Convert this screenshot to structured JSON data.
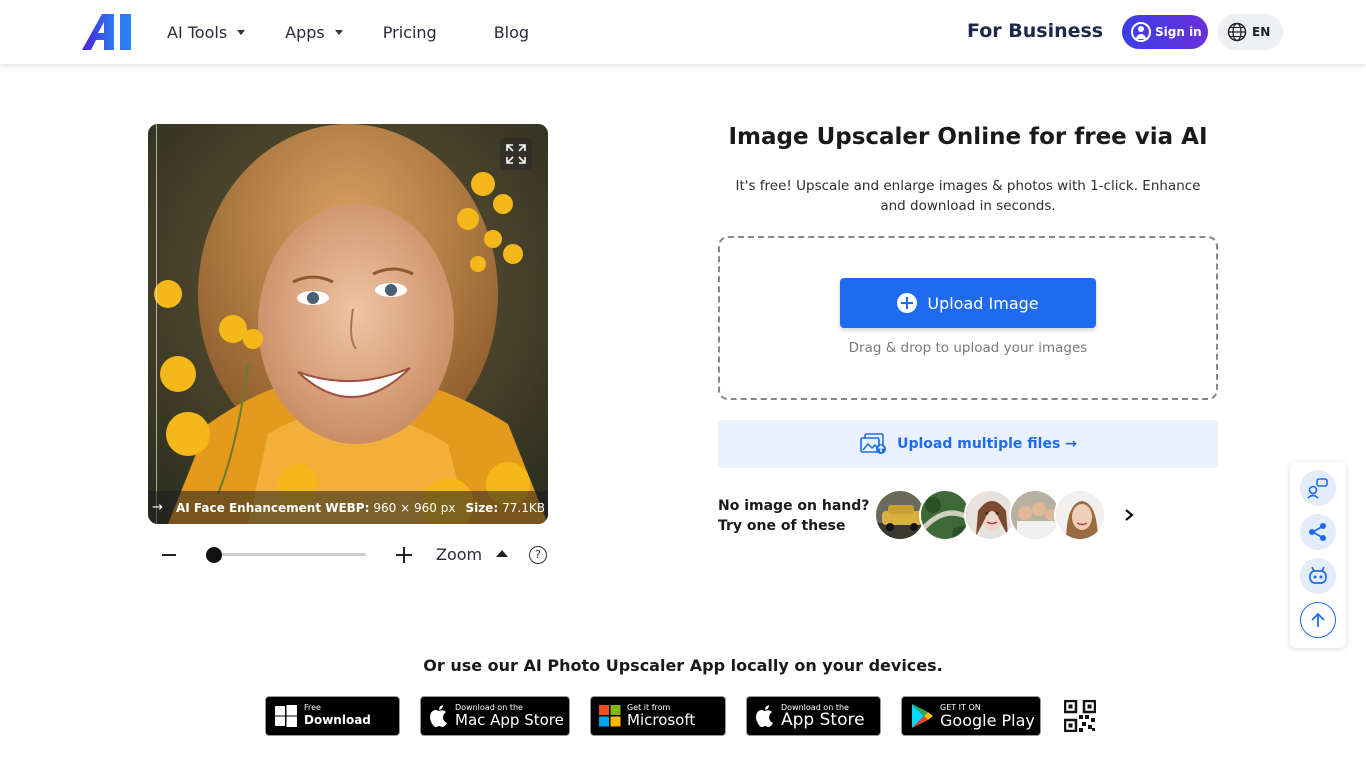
{
  "header": {
    "logo_text": "AI",
    "nav": [
      {
        "label": "AI Tools",
        "dropdown": true
      },
      {
        "label": "Apps",
        "dropdown": true
      },
      {
        "label": "Pricing",
        "dropdown": false
      },
      {
        "label": "Blog",
        "dropdown": false
      }
    ],
    "for_business": "For Business",
    "sign_in": "Sign in",
    "language": "EN"
  },
  "preview": {
    "info_title": "AI Face Enhancement WEBP:",
    "dimensions": "960 × 960 px",
    "size_label": "Size:",
    "size_value": "77.1KB",
    "compare_arrow": "→"
  },
  "zoom": {
    "label": "Zoom",
    "help": "?",
    "level": 0.05
  },
  "main": {
    "title": "Image Upscaler Online for free via AI",
    "subtitle": "It's free! Upscale and enlarge images & photos with 1-click. Enhance and download in seconds.",
    "upload_button": "Upload Image",
    "drag_hint": "Drag & drop to upload your images",
    "multi_upload": "Upload multiple files →",
    "samples_label_1": "No image on hand?",
    "samples_label_2": "Try one of these"
  },
  "apps": {
    "title": "Or use our AI Photo Upscaler App locally on your devices.",
    "stores": [
      {
        "small": "Free",
        "big": "Download",
        "icon": "windows-icon"
      },
      {
        "small": "Download on the",
        "big": "Mac App Store",
        "icon": "apple-icon"
      },
      {
        "small": "Get it from",
        "big": "Microsoft",
        "icon": "microsoft-icon"
      },
      {
        "small": "Download on the",
        "big": "App Store",
        "icon": "apple-icon"
      },
      {
        "small": "GET IT ON",
        "big": "Google Play",
        "icon": "google-play-icon"
      }
    ]
  },
  "colors": {
    "primary": "#1f6bf0",
    "signin_gradient_start": "#3b3fe8",
    "signin_gradient_end": "#6a2fd8",
    "multi_upload_bg": "#e8f1fd"
  }
}
